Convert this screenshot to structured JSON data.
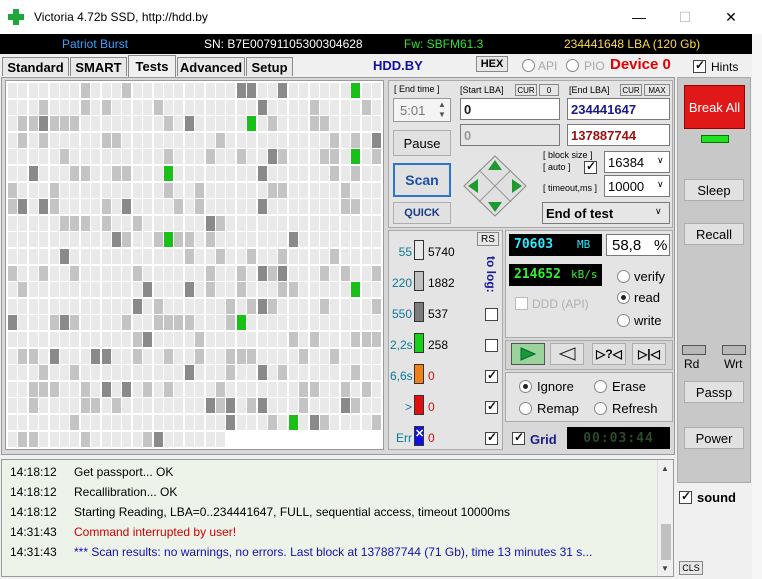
{
  "window": {
    "title": "Victoria 4.72b SSD, http://hdd.by",
    "minimize_icon": "—",
    "maximize_icon": "☐",
    "close_icon": "✕"
  },
  "infobar": {
    "model": "Patriot Burst",
    "serial": "SN: B7E00791105300304628",
    "firmware": "Fw: SBFM61.3",
    "capacity": "234441648 LBA (120 Gb)"
  },
  "tabs": [
    "Standard",
    "SMART",
    "Tests",
    "Advanced",
    "Setup"
  ],
  "header": {
    "site": "HDD.BY",
    "hex": "HEX",
    "api": "API",
    "pio": "PIO",
    "device": "Device 0",
    "hints": "Hints"
  },
  "controls": {
    "end_time_label": "[ End time ]",
    "end_time_value": "5:01",
    "start_lba_label": "[Start LBA]",
    "cur_label": "CUR",
    "zero_label": "0",
    "end_lba_label": "[End LBA]",
    "max_label": "MAX",
    "start_lba": "0",
    "end_lba": "234441647",
    "current_lba": "0",
    "last_lba": "137887744",
    "pause": "Pause",
    "scan": "Scan",
    "quick": "QUICK",
    "block_size_label": "[ block size ]",
    "auto_label": "[ auto ]",
    "block_size": "16384",
    "timeout_label": "[ timeout,ms ]",
    "timeout": "10000",
    "end_mode": "End of test"
  },
  "legend": {
    "rs": "RS",
    "to_log": "to log:",
    "rows": [
      {
        "label": "55",
        "count": "5740",
        "color": "#e8e8e8"
      },
      {
        "label": "220",
        "count": "1882",
        "color": "#c0c0c0"
      },
      {
        "label": "550",
        "count": "537",
        "color": "#7c7c7c"
      },
      {
        "label": "2,2s",
        "count": "258",
        "color": "#18d018"
      },
      {
        "label": "6,6s",
        "count": "0",
        "color": "#f08018"
      },
      {
        "label": ">",
        "count": "0",
        "color": "#e01010"
      },
      {
        "label": "Err",
        "count": "0",
        "color": "#1010e0"
      }
    ]
  },
  "stats": {
    "mb": "70603",
    "mb_unit": "MB",
    "percent": "58,8",
    "percent_unit": "%",
    "speed": "214652",
    "speed_unit": "kB/s",
    "ddd": "DDD (API)",
    "timer": "00:03:44"
  },
  "modes": {
    "verify": "verify",
    "read": "read",
    "write": "write"
  },
  "actions": {
    "ignore": "Ignore",
    "erase": "Erase",
    "remap": "Remap",
    "refresh": "Refresh",
    "grid": "Grid"
  },
  "right": {
    "break_all": "Break All",
    "sleep": "Sleep",
    "recall": "Recall",
    "rd": "Rd",
    "wrt": "Wrt",
    "passp": "Passp",
    "power": "Power",
    "sound": "sound",
    "cls": "CLS"
  },
  "log": [
    {
      "time": "14:18:12",
      "msg": "Get passport... OK",
      "color": "#000000"
    },
    {
      "time": "14:18:12",
      "msg": "Recallibration... OK",
      "color": "#000000"
    },
    {
      "time": "14:18:12",
      "msg": "Starting Reading, LBA=0..234441647, FULL, sequential access, timeout 10000ms",
      "color": "#000000"
    },
    {
      "time": "14:31:43",
      "msg": "Command interrupted by user!",
      "color": "#d00000"
    },
    {
      "time": "14:31:43",
      "msg": "*** Scan results: no warnings, no errors. Last block at 137887744 (71 Gb), time 13 minutes 31 s...",
      "color": "#1010b0"
    }
  ]
}
